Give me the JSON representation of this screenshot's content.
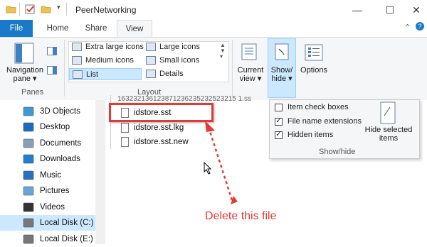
{
  "window": {
    "title": "PeerNetworking",
    "minimize": "—",
    "maximize": "☐",
    "close": "✕",
    "collapse_chevron": "⌃",
    "help": "?"
  },
  "tabs": [
    "File",
    "Home",
    "Share",
    "View"
  ],
  "ribbon": {
    "panes": {
      "navigation_pane_label": "Navigation pane ▾",
      "group_label": "Panes"
    },
    "layout": {
      "group_label": "Layout",
      "options": [
        {
          "label": "Extra large icons"
        },
        {
          "label": "Large icons"
        },
        {
          "label": "Medium icons"
        },
        {
          "label": "Small icons"
        },
        {
          "label": "List",
          "selected": true
        },
        {
          "label": "Details"
        }
      ]
    },
    "current_view_label": "Current view ▾",
    "show_hide_label": "Show/ hide ▾",
    "options_label": "Options"
  },
  "nav": {
    "items": [
      {
        "label": "3D Objects",
        "icon": "3d-objects-icon",
        "color": "#3c9bd6"
      },
      {
        "label": "Desktop",
        "icon": "desktop-icon",
        "color": "#1d6bbf"
      },
      {
        "label": "Documents",
        "icon": "documents-icon",
        "color": "#8aa0b8"
      },
      {
        "label": "Downloads",
        "icon": "downloads-icon",
        "color": "#1f7fd0"
      },
      {
        "label": "Music",
        "icon": "music-icon",
        "color": "#2b6fc0"
      },
      {
        "label": "Pictures",
        "icon": "pictures-icon",
        "color": "#6ba4d8"
      },
      {
        "label": "Videos",
        "icon": "videos-icon",
        "color": "#333333"
      },
      {
        "label": "Local Disk (C:)",
        "icon": "drive-icon",
        "color": "#777777",
        "selected": true
      },
      {
        "label": "Local Disk (E:)",
        "icon": "drive-icon",
        "color": "#777777"
      }
    ]
  },
  "files": {
    "truncated_name": "163232136123871236235232523215 1.ss",
    "items": [
      {
        "name": "idstore.sst",
        "highlighted": true
      },
      {
        "name": "idstore.sst.lkg"
      },
      {
        "name": "idstore.sst.new"
      }
    ]
  },
  "show_hide_panel": {
    "checkboxes": [
      {
        "label": "Item check boxes",
        "checked": false
      },
      {
        "label": "File name extensions",
        "checked": true
      },
      {
        "label": "Hidden items",
        "checked": true
      }
    ],
    "hide_selected_label": "Hide selected items",
    "group_label": "Show/hide"
  },
  "annotation": {
    "text": "Delete this file",
    "color": "#e53935"
  },
  "colors": {
    "accent": "#1979ca",
    "folder": "#f0c24d",
    "selection": "#cce8ff"
  }
}
